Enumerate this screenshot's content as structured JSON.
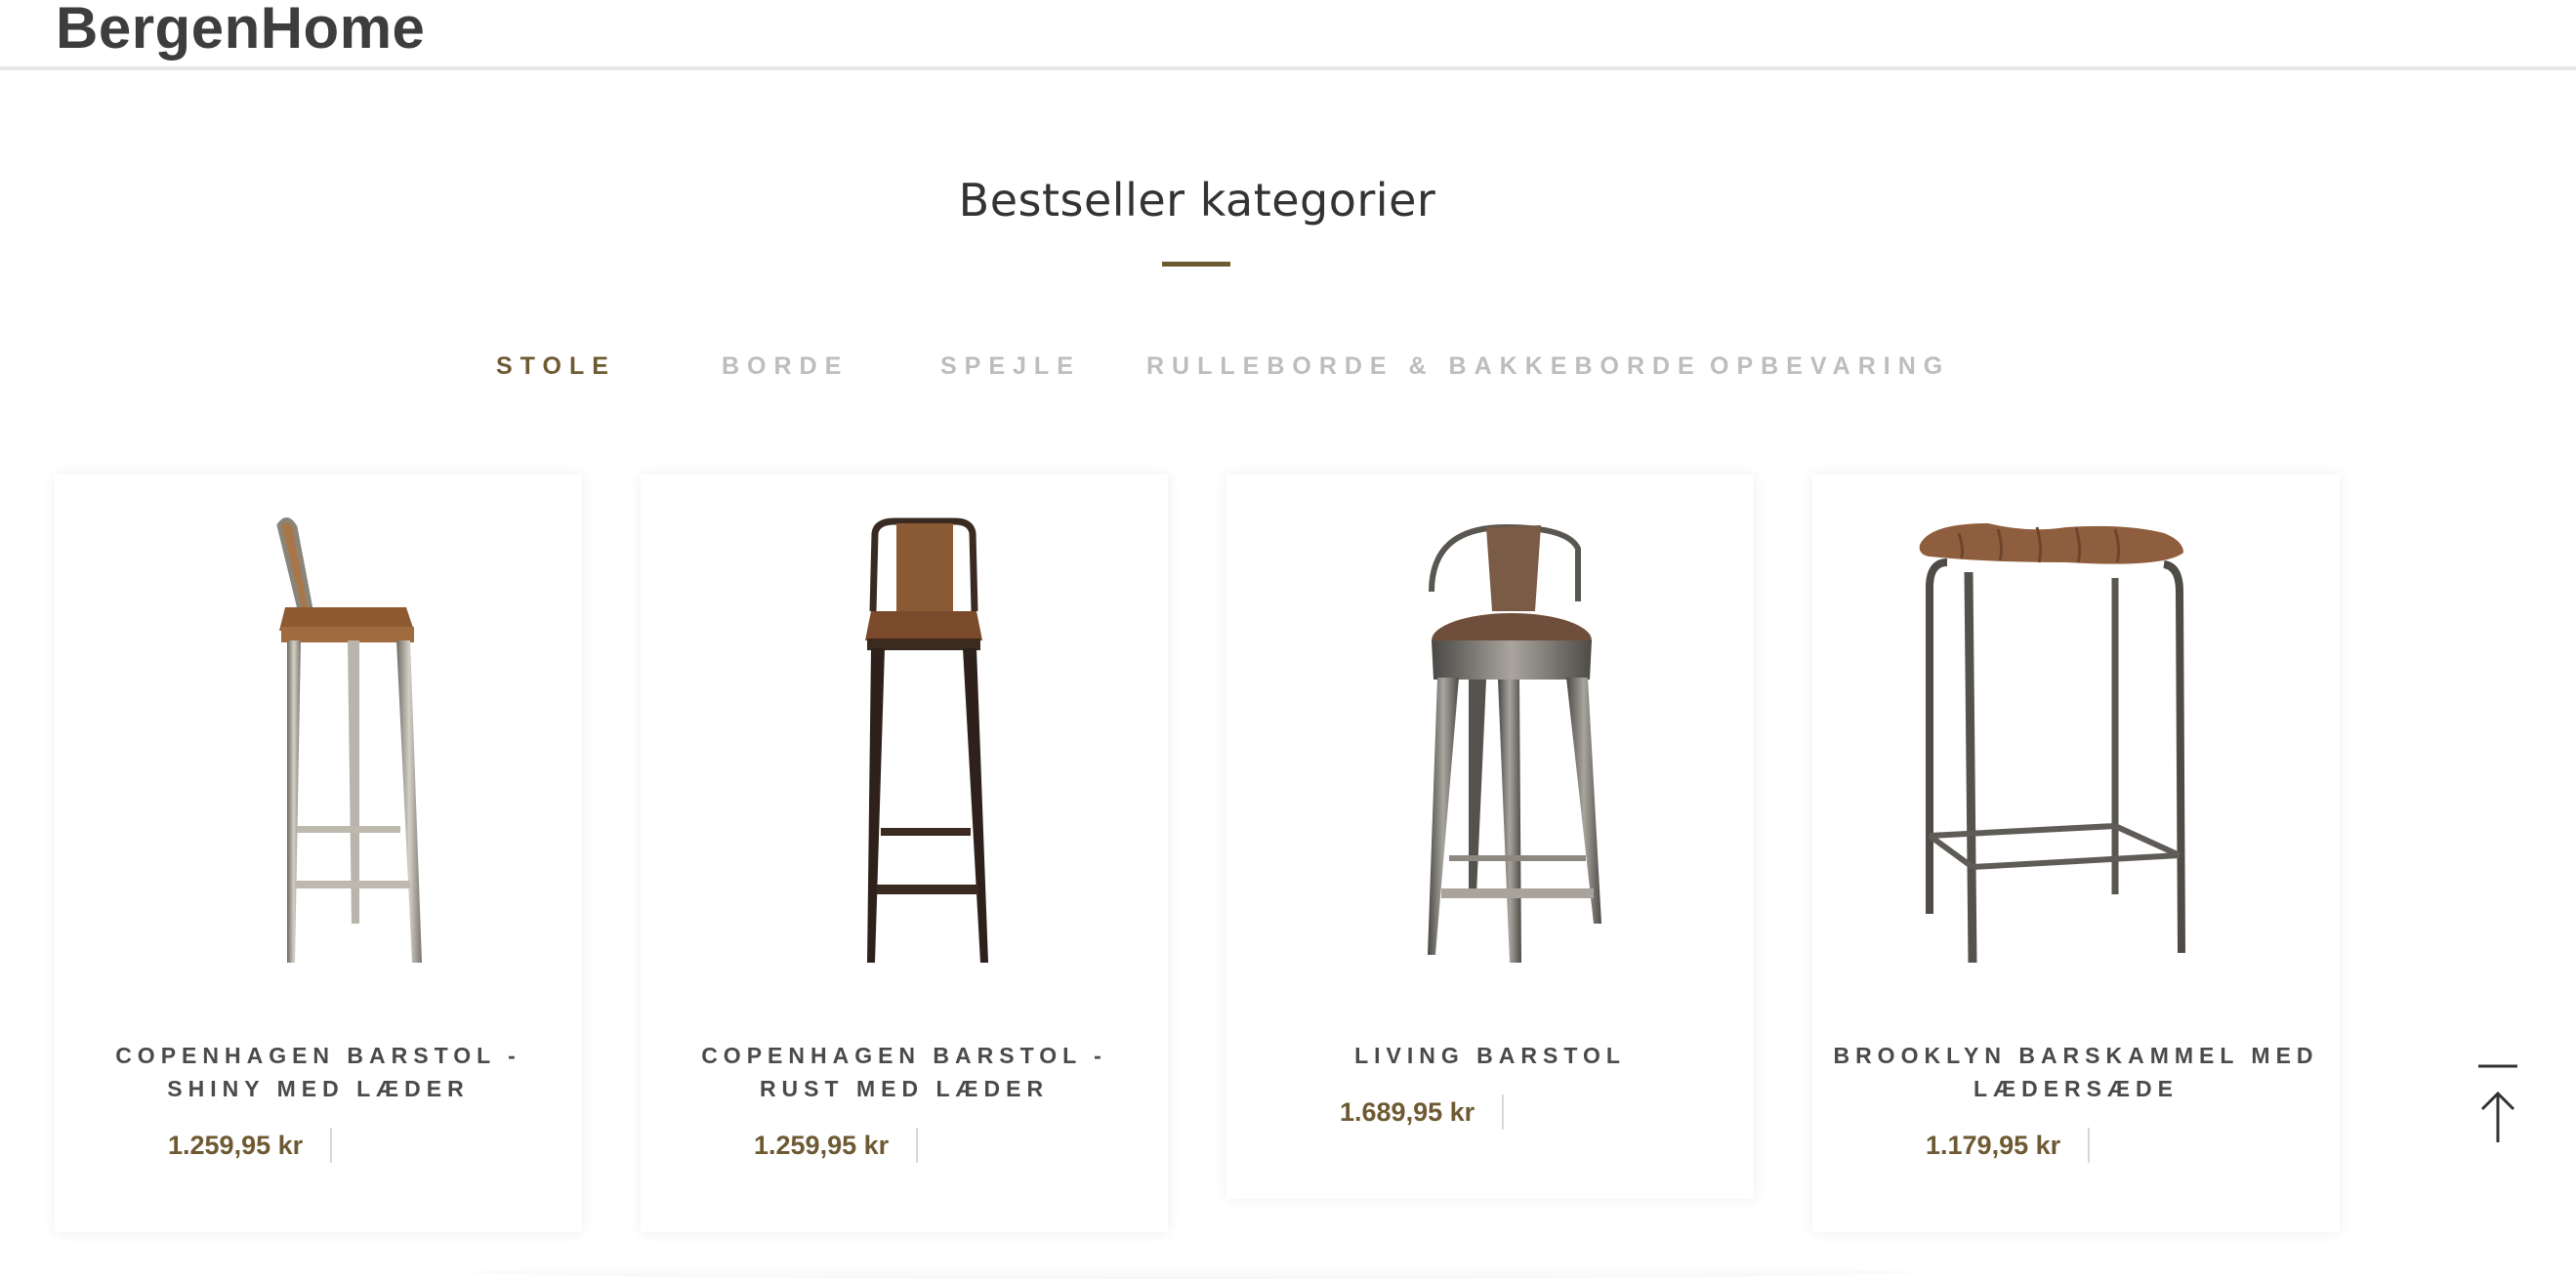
{
  "site": {
    "logo": "BergenHome"
  },
  "section": {
    "title": "Bestseller kategorier"
  },
  "tabs": [
    {
      "label": "STOLE",
      "active": true
    },
    {
      "label": "BORDE",
      "active": false
    },
    {
      "label": "SPEJLE",
      "active": false
    },
    {
      "label": "RULLEBORDE & BAKKEBORDE",
      "active": false
    },
    {
      "label": "OPBEVARING",
      "active": false
    }
  ],
  "products": [
    {
      "name_line1": "COPENHAGEN BARSTOL -",
      "name_line2": "SHINY MED LÆDER",
      "price": "1.259,95 kr",
      "image": "bar-stool-shiny-leather-image"
    },
    {
      "name_line1": "COPENHAGEN BARSTOL -",
      "name_line2": "RUST MED LÆDER",
      "price": "1.259,95 kr",
      "image": "bar-stool-rust-leather-image"
    },
    {
      "name_line1": "LIVING BARSTOL",
      "name_line2": "",
      "price": "1.689,95 kr",
      "image": "living-bar-stool-image"
    },
    {
      "name_line1": "BROOKLYN BARSKAMMEL MED",
      "name_line2": "LÆDERSÆDE",
      "price": "1.179,95 kr",
      "image": "brooklyn-bar-stool-image"
    }
  ],
  "icons": {
    "back_to_top": "arrow-up-to-top-icon"
  },
  "colors": {
    "accent": "#6e5a32",
    "tab_inactive": "#bdbdbd",
    "text": "#4a4a4a"
  }
}
